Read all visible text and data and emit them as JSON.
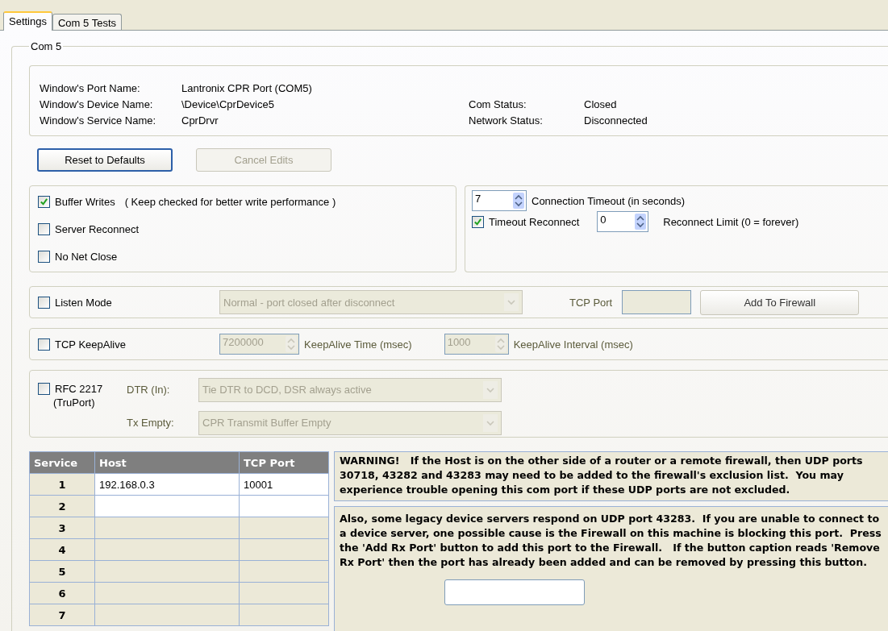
{
  "tabs": [
    {
      "label": "Settings",
      "selected": true
    },
    {
      "label": "Com 5 Tests",
      "selected": false
    }
  ],
  "group": {
    "title": "Com 5"
  },
  "info": {
    "left": [
      {
        "label": "Window's Port Name:",
        "value": "Lantronix CPR Port (COM5)"
      },
      {
        "label": "Window's Device Name:",
        "value": "\\Device\\CprDevice5"
      },
      {
        "label": "Window's Service Name:",
        "value": "CprDrvr"
      }
    ],
    "right": [
      {
        "label": "Com Status:",
        "value": "Closed"
      },
      {
        "label": "Network Status:",
        "value": "Disconnected"
      }
    ]
  },
  "buttons": [
    {
      "label": "Reset to Defaults",
      "disabled": false
    },
    {
      "label": "Cancel Edits",
      "disabled": true
    }
  ],
  "options": [
    {
      "label": "Buffer Writes",
      "note": "( Keep checked for better write performance )",
      "checked": true
    },
    {
      "label": "Server Reconnect",
      "checked": false
    },
    {
      "label": "No Net Close",
      "checked": false
    }
  ],
  "timeout": {
    "value": "7",
    "label": "Connection Timeout (in seconds)",
    "reconnect": {
      "label": "Timeout Reconnect",
      "checked": true
    },
    "limit": {
      "value": "0",
      "label": "Reconnect Limit (0 = forever)"
    }
  },
  "listen": {
    "label": "Listen Mode",
    "checked": false,
    "mode": {
      "value": "Normal - port closed after disconnect",
      "disabled": true
    },
    "port_label": "TCP Port",
    "port_value_disabled": true,
    "firewall_button": "Add To Firewall"
  },
  "keepalive": {
    "label": "TCP KeepAlive",
    "checked": false,
    "time": {
      "value": "7200000",
      "label": "KeepAlive Time (msec)",
      "disabled": true
    },
    "interval": {
      "value": "1000",
      "label": "KeepAlive Interval (msec)",
      "disabled": true
    }
  },
  "rfc": {
    "label": "RFC 2217",
    "sublabel": "(TruPort)",
    "checked": false,
    "dtr": {
      "label": "DTR (In):",
      "value": "Tie DTR to DCD, DSR always active",
      "disabled": true
    },
    "tx": {
      "label": "Tx Empty:",
      "value": "CPR Transmit Buffer Empty",
      "disabled": true
    }
  },
  "table": {
    "columns": [
      "Service",
      "Host",
      "TCP Port"
    ],
    "rows": [
      {
        "service": "1",
        "host": "192.168.0.3",
        "port": "10001",
        "editable": true
      },
      {
        "service": "2",
        "editable": true
      },
      {
        "service": "3",
        "editable": false
      },
      {
        "service": "4",
        "editable": false
      },
      {
        "service": "5",
        "editable": false
      },
      {
        "service": "6",
        "editable": false
      },
      {
        "service": "7",
        "editable": false
      }
    ]
  },
  "warning": "WARNING!   If the Host is on the other side of a router or a remote firewall, then UDP ports 30718, 43282 and 43283 may need to be added to the firewall's exclusion list.  You may experience trouble opening this com port if these UDP ports are not excluded.",
  "note": "Also, some legacy device servers respond on UDP port 43283.  If you are unable to connect to a device server, one possible cause is the Firewall on this machine is blocking this port.  Press the 'Add Rx Port' button to add this port to the Firewall.   If the button caption reads 'Remove Rx Port' then the port has already been added and can be removed by pressing this button."
}
